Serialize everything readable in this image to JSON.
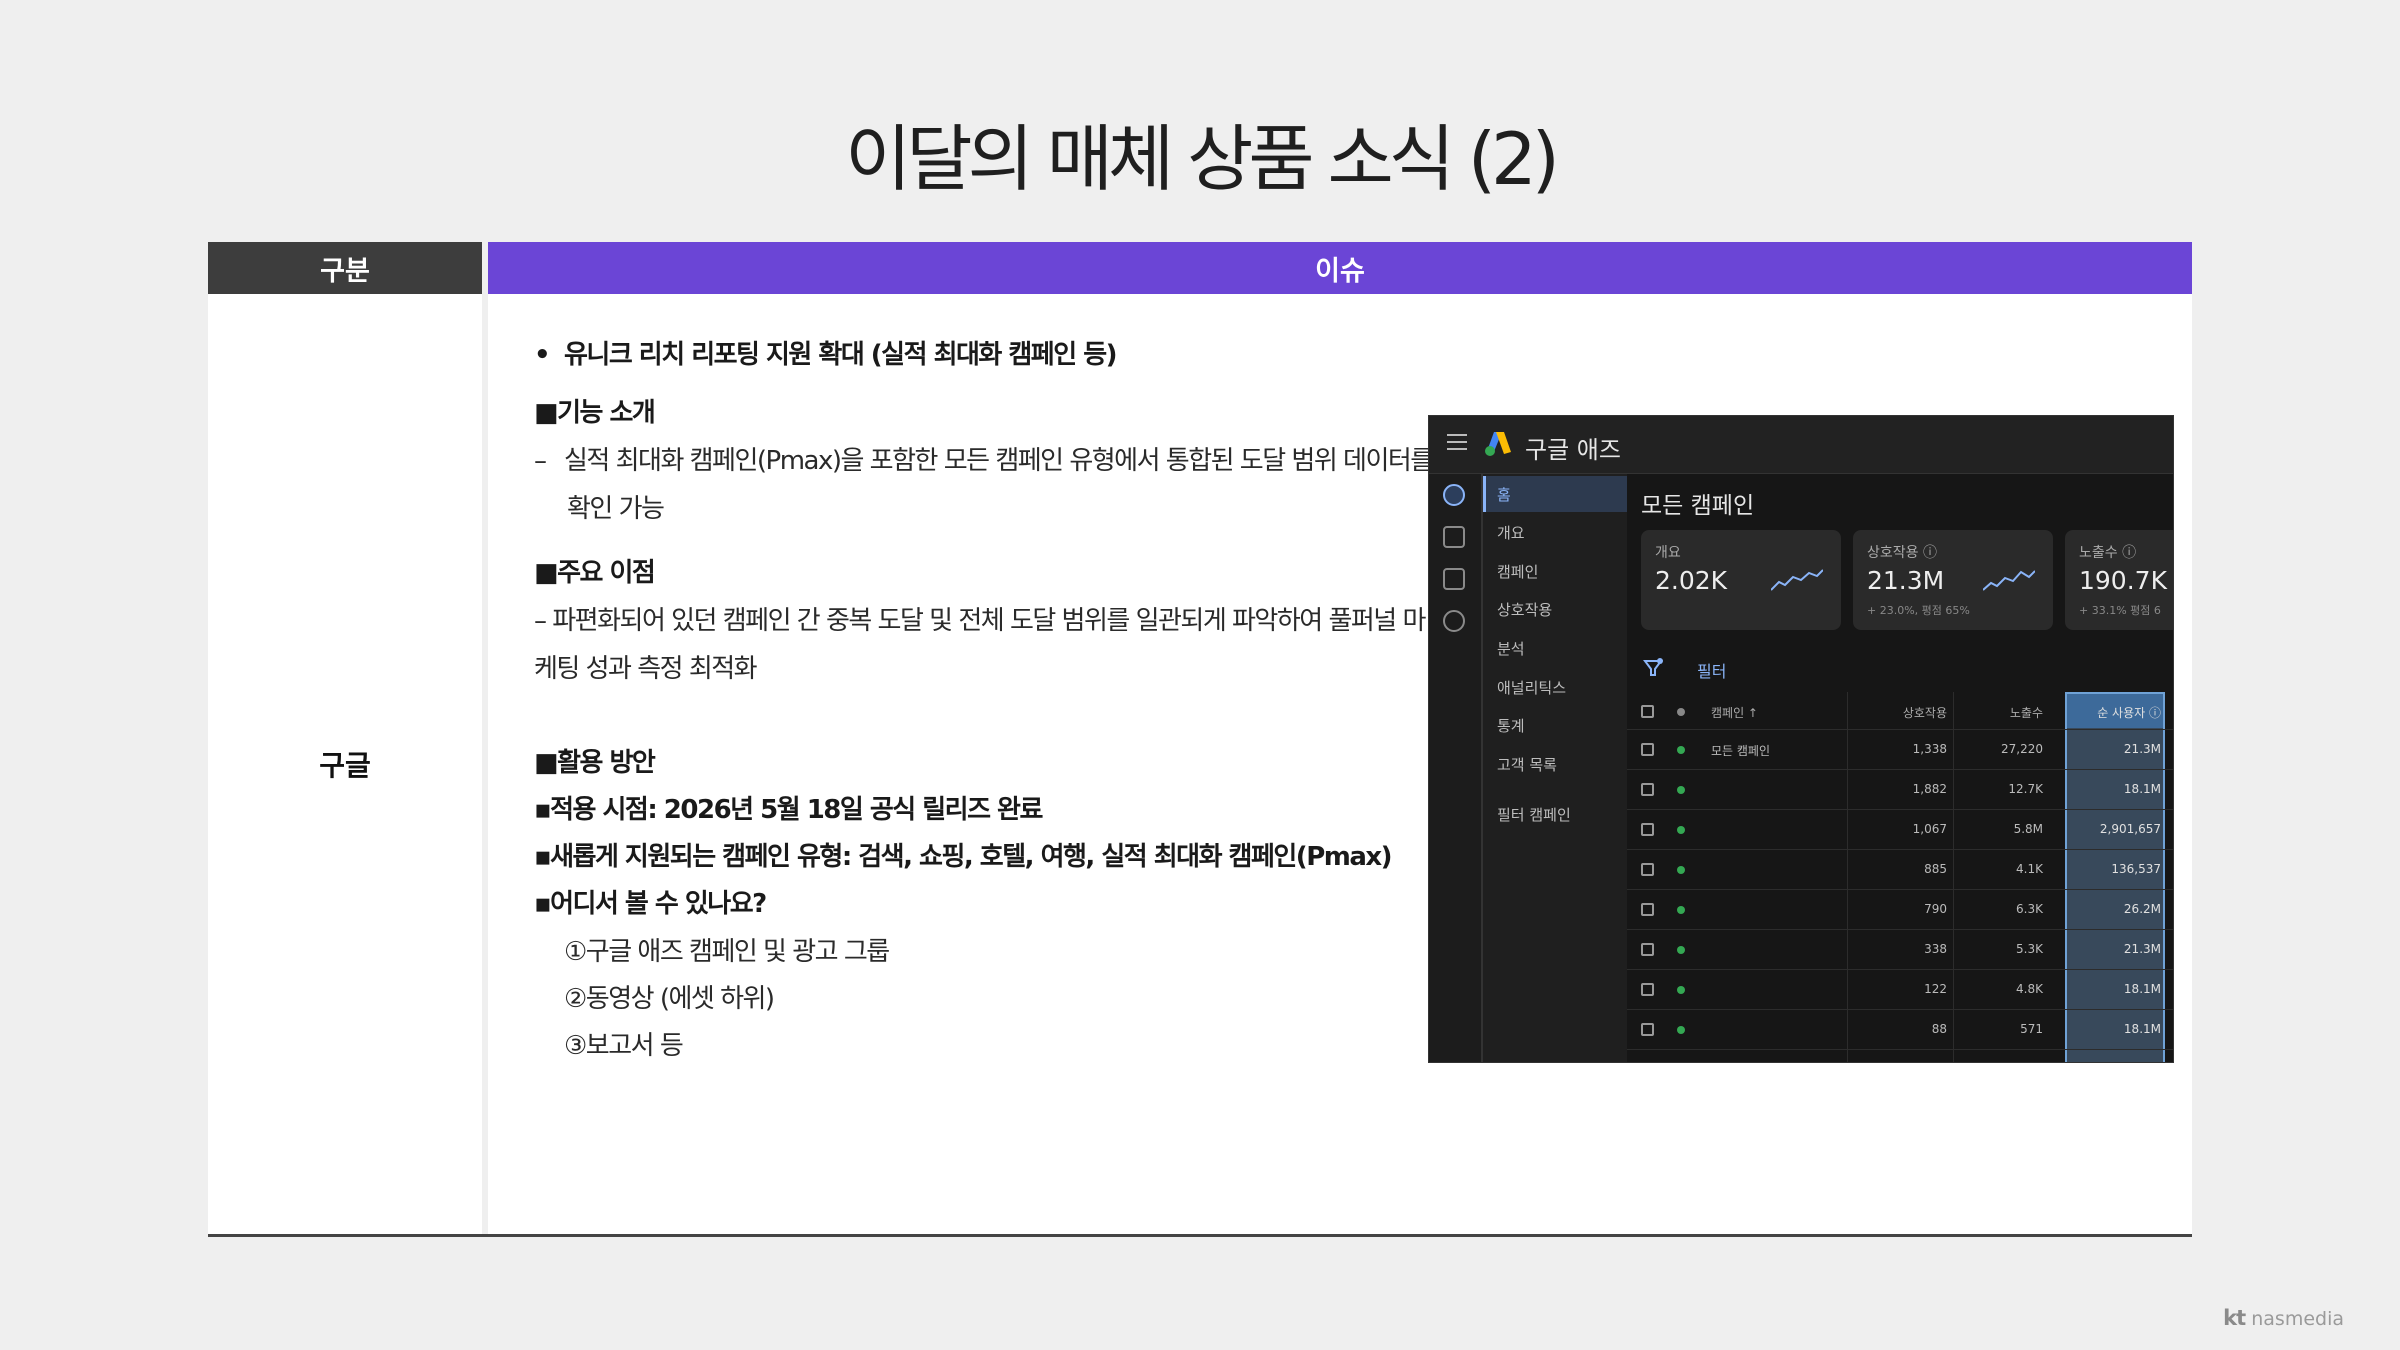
{
  "slide": {
    "title": "이달의 매체 상품 소식 (2)"
  },
  "table": {
    "col_category": "구분",
    "col_issue": "이슈",
    "category": "구글"
  },
  "content": {
    "headline_bullet": "•",
    "headline": "유니크 리치 리포팅 지원 확대 (실적 최대화 캠페인 등)",
    "sec1_title": "■기능 소개",
    "sec1_dash": "–",
    "sec1_line1": "실적 최대화 캠페인(Pmax)을 포함한 모든 캠페인 유형에서 통합된 도달 범위 데이터를",
    "sec1_line2": "확인 가능",
    "sec2_title": "■주요 이점",
    "sec2_line1": "– 파편화되어 있던 캠페인 간 중복 도달 및 전체 도달 범위를 일관되게 파악하여 풀퍼널 마",
    "sec2_line2": "케팅 성과 측정 최적화",
    "sec3_title": "■활용 방안",
    "sec3_item1": "▪적용 시점: 2026년 5월 18일 공식 릴리즈 완료",
    "sec3_item2": "▪새롭게 지원되는 캠페인 유형: 검색, 쇼핑, 호텔, 여행, 실적 최대화 캠페인(Pmax)",
    "sec3_item3": "▪어디서 볼 수 있나요?",
    "sec3_sub1": "①구글 애즈 캠페인 및 광고 그룹",
    "sec3_sub2": "②동영상 (에셋 하위)",
    "sec3_sub3": "③보고서 등"
  },
  "screenshot": {
    "app_title": "구글 애즈",
    "nav": [
      "홈",
      "개요",
      "캠페인",
      "상호작용",
      "분석",
      "애널리틱스",
      "통계",
      "고객 목록",
      "필터 캠페인"
    ],
    "page_title": "모든 캠페인",
    "cards": [
      {
        "label": "개요",
        "value": "2.02K",
        "sub": ""
      },
      {
        "label": "상호작용 ⓘ",
        "value": "21.3M",
        "sub": "+ 23.0%, 평점 65%"
      },
      {
        "label": "노출수 ⓘ",
        "value": "190.7K",
        "sub": "+ 33.1% 평점 6"
      }
    ],
    "filter_label": "필터",
    "columns": {
      "name": "캠페인 ↑",
      "interactions": "상호작용",
      "impressions": "노출수",
      "users": "순 사용자 ⓘ"
    },
    "rows": [
      {
        "name": "모든 캠페인",
        "interactions": "1,338",
        "impressions": "27,220",
        "users": "21.3M"
      },
      {
        "name": "",
        "interactions": "1,882",
        "impressions": "12.7K",
        "users": "18.1M"
      },
      {
        "name": "",
        "interactions": "1,067",
        "impressions": "5.8M",
        "users": "2,901,657"
      },
      {
        "name": "",
        "interactions": "885",
        "impressions": "4.1K",
        "users": "136,537"
      },
      {
        "name": "",
        "interactions": "790",
        "impressions": "6.3K",
        "users": "26.2M"
      },
      {
        "name": "",
        "interactions": "338",
        "impressions": "5.3K",
        "users": "21.3M"
      },
      {
        "name": "",
        "interactions": "122",
        "impressions": "4.8K",
        "users": "18.1M"
      },
      {
        "name": "",
        "interactions": "88",
        "impressions": "571",
        "users": "18.1M"
      }
    ],
    "icons": [
      "menu-icon",
      "google-ads-logo-icon",
      "home-icon",
      "campaign-icon",
      "report-icon",
      "settings-icon",
      "filter-icon",
      "sparkline-icon"
    ],
    "colors": {
      "accent": "#8ab4f8",
      "highlight_column": "#6fa2d6",
      "status_dot": "#34a853"
    }
  },
  "footer": {
    "brand_kt": "kt",
    "brand_name": "nasmedia"
  },
  "colors": {
    "header_dark": "#3d3d3d",
    "header_purple": "#6b45d6"
  }
}
